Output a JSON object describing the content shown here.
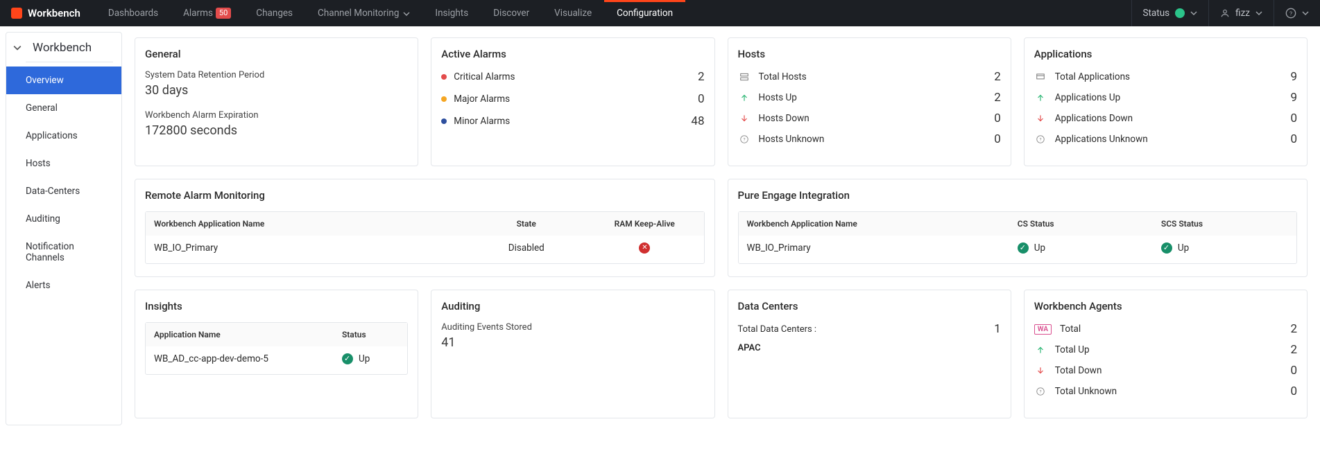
{
  "brand": "Workbench",
  "nav": {
    "dashboards": "Dashboards",
    "alarms": "Alarms",
    "alarms_badge": "50",
    "changes": "Changes",
    "channel_monitoring": "Channel Monitoring",
    "insights": "Insights",
    "discover": "Discover",
    "visualize": "Visualize",
    "configuration": "Configuration"
  },
  "topright": {
    "status_label": "Status",
    "user": "fizz"
  },
  "sidebar": {
    "title": "Workbench",
    "items": [
      "Overview",
      "General",
      "Applications",
      "Hosts",
      "Data-Centers",
      "Auditing",
      "Notification Channels",
      "Alerts"
    ]
  },
  "general": {
    "title": "General",
    "retention_label": "System Data Retention Period",
    "retention_value": "30 days",
    "expiration_label": "Workbench Alarm Expiration",
    "expiration_value": "172800 seconds"
  },
  "alarms": {
    "title": "Active Alarms",
    "critical_label": "Critical Alarms",
    "critical_value": "2",
    "major_label": "Major Alarms",
    "major_value": "0",
    "minor_label": "Minor Alarms",
    "minor_value": "48"
  },
  "hosts": {
    "title": "Hosts",
    "total_label": "Total Hosts",
    "total_value": "2",
    "up_label": "Hosts Up",
    "up_value": "2",
    "down_label": "Hosts Down",
    "down_value": "0",
    "unknown_label": "Hosts Unknown",
    "unknown_value": "0"
  },
  "apps": {
    "title": "Applications",
    "total_label": "Total Applications",
    "total_value": "9",
    "up_label": "Applications Up",
    "up_value": "9",
    "down_label": "Applications Down",
    "down_value": "0",
    "unknown_label": "Applications Unknown",
    "unknown_value": "0"
  },
  "ram": {
    "title": "Remote Alarm Monitoring",
    "h1": "Workbench Application Name",
    "h2": "State",
    "h3": "RAM Keep-Alive",
    "r1_name": "WB_IO_Primary",
    "r1_state": "Disabled"
  },
  "pei": {
    "title": "Pure Engage Integration",
    "h1": "Workbench Application Name",
    "h2": "CS Status",
    "h3": "SCS Status",
    "r1_name": "WB_IO_Primary",
    "r1_cs": "Up",
    "r1_scs": "Up"
  },
  "insights": {
    "title": "Insights",
    "h1": "Application Name",
    "h2": "Status",
    "r1_name": "WB_AD_cc-app-dev-demo-5",
    "r1_status": "Up"
  },
  "auditing": {
    "title": "Auditing",
    "label": "Auditing Events Stored",
    "value": "41"
  },
  "dc": {
    "title": "Data Centers",
    "total_label": "Total Data Centers :",
    "total_value": "1",
    "region": "APAC"
  },
  "agents": {
    "title": "Workbench Agents",
    "badge": "WA",
    "total_label": "Total",
    "total_value": "2",
    "up_label": "Total Up",
    "up_value": "2",
    "down_label": "Total Down",
    "down_value": "0",
    "unknown_label": "Total Unknown",
    "unknown_value": "0"
  }
}
